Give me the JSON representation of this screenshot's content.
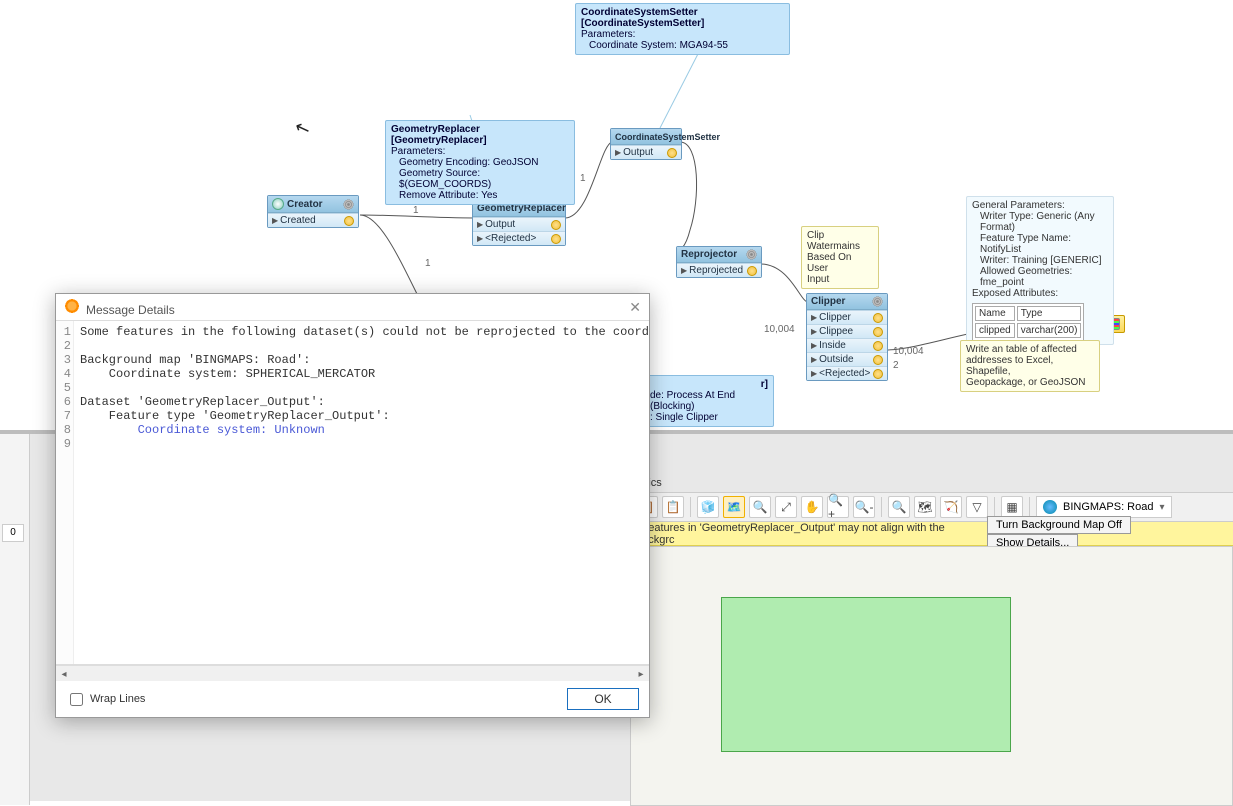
{
  "cursor_glyph": "↖",
  "canvas": {
    "creator": {
      "title": "Creator",
      "port": "Created"
    },
    "geom_replacer": {
      "title": "GeometryReplacer",
      "ports": [
        "Output",
        "<Rejected>"
      ]
    },
    "coord_setter": {
      "title": "CoordinateSystemSetter",
      "port": "Output"
    },
    "reprojector": {
      "title": "Reprojector",
      "port": "Reprojected"
    },
    "clipper": {
      "title": "Clipper",
      "ports": [
        "Clipper",
        "Clippee",
        "Inside",
        "Outside",
        "<Rejected>"
      ]
    },
    "writer": {
      "title": "NotifyList"
    },
    "hidden_node": {
      "line1": "de: Process At End (Blocking)",
      "line2": ": Single Clipper"
    },
    "edge_labels": {
      "a": "1",
      "b": "1",
      "c": "1",
      "d": "10,004",
      "e": "10,004",
      "f": "2"
    }
  },
  "annotations": {
    "coord_setter": {
      "title": "CoordinateSystemSetter [CoordinateSystemSetter]",
      "sub": "Parameters:",
      "l1": "Coordinate System: MGA94-55"
    },
    "geom_replacer": {
      "title": "GeometryReplacer [GeometryReplacer]",
      "sub": "Parameters:",
      "l1": "Geometry Encoding: GeoJSON",
      "l2": "Geometry Source: $(GEOM_COORDS)",
      "l3": "Remove Attribute: Yes"
    },
    "clip_note": {
      "l1": "Clip Watermains",
      "l2": "Based On User",
      "l3": "Input"
    },
    "writer_info": {
      "l1": "General Parameters:",
      "l2": "Writer Type: Generic (Any Format)",
      "l3": "Feature Type Name: NotifyList",
      "l4": "Writer: Training [GENERIC]",
      "l5": "Allowed Geometries: fme_point",
      "l6": "Exposed Attributes:",
      "th1": "Name",
      "th2": "Type",
      "td1": "clipped",
      "td2": "varchar(200)"
    },
    "writer_note": {
      "l1": "Write an table of affected",
      "l2": "addresses to Excel, Shapefile,",
      "l3": "Geopackage, or GeoJSON"
    }
  },
  "viewer": {
    "tab": "aphics",
    "toolbar_icons": [
      "📋",
      "📋",
      "🧊",
      "🗺️",
      "🔍",
      "⤢",
      "✋",
      "🔍+",
      "🔍-",
      "🔍",
      "🗺",
      "🏹",
      "▽",
      "▦"
    ],
    "basemap": "BINGMAPS: Road",
    "warning_text": "e features in 'GeometryReplacer_Output' may not align with the backgrc",
    "btn_off": "Turn Background Map Off",
    "btn_details": "Show Details..."
  },
  "left_cell": "0",
  "dialog": {
    "title": "Message Details",
    "gutter": "1\n2\n3\n4\n5\n6\n7\n8\n9",
    "line1": "Some features in the following dataset(s) could not be reprojected to the coord",
    "line2": "",
    "line3": "Background map 'BINGMAPS: Road':",
    "line4": "    Coordinate system: SPHERICAL_MERCATOR",
    "line5": "",
    "line6": "Dataset 'GeometryReplacer_Output':",
    "line7": "    Feature type 'GeometryReplacer_Output':",
    "line8_pre": "        ",
    "line8_unk": "Coordinate system: Unknown",
    "wrap_label": "Wrap Lines",
    "ok": "OK"
  }
}
